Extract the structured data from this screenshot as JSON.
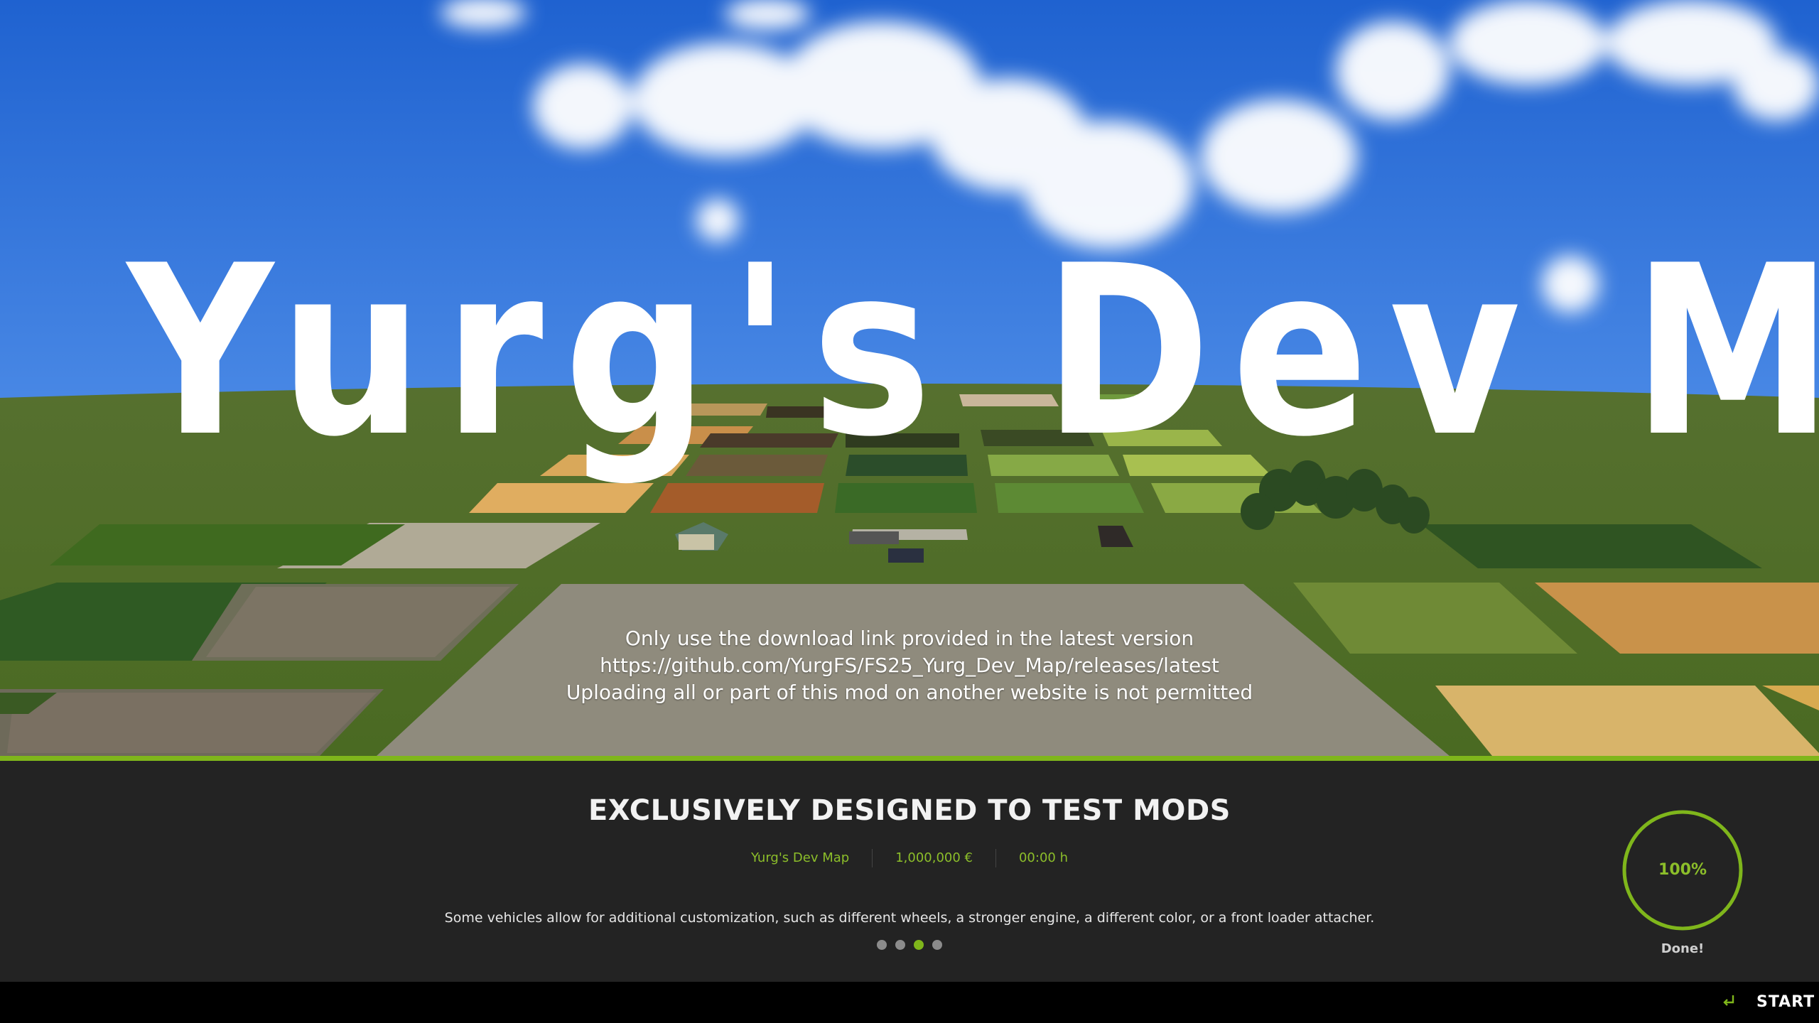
{
  "hero": {
    "title": "Yurg's Dev Map",
    "notice_lines": [
      "Only use the download link provided in the latest version",
      "https://github.com/YurgFS/FS25_Yurg_Dev_Map/releases/latest",
      "Uploading all or part of this mod on another website is not permitted"
    ]
  },
  "panel": {
    "headline": "EXCLUSIVELY DESIGNED TO TEST MODS",
    "meta": {
      "map_name": "Yurg's Dev Map",
      "money": "1,000,000 €",
      "playtime": "00:00 h"
    },
    "tip": "Some vehicles allow for additional customization, such as different wheels, a stronger engine, a different color, or a front loader attacher.",
    "tip_pages": 4,
    "tip_active_index": 2,
    "progress": {
      "value_text": "100%",
      "fraction": 1.0,
      "status": "Done!"
    }
  },
  "bottombar": {
    "start_label": "START",
    "start_icon": "enter-key-icon"
  },
  "colors": {
    "accent": "#7fb61b",
    "panel_bg": "#232323",
    "sky": "#2d6fd6",
    "grass": "#4f6a2b"
  }
}
